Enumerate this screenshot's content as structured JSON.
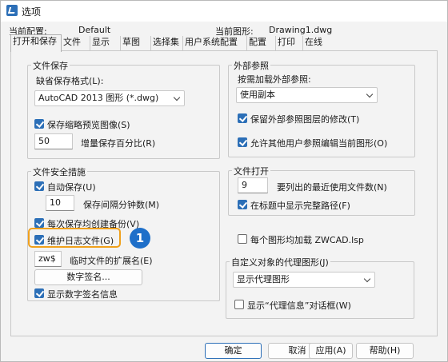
{
  "window": {
    "title": "选项"
  },
  "profile": {
    "current_profile_label": "当前配置:",
    "current_profile_value": "Default",
    "current_drawing_label": "当前图形:",
    "current_drawing_value": "Drawing1.dwg"
  },
  "tabs": [
    {
      "label": "打开和保存",
      "active": true
    },
    {
      "label": "文件"
    },
    {
      "label": "显示"
    },
    {
      "label": "草图"
    },
    {
      "label": "选择集"
    },
    {
      "label": "用户系统配置"
    },
    {
      "label": "配置"
    },
    {
      "label": "打印"
    },
    {
      "label": "在线"
    }
  ],
  "file_save": {
    "title": "文件保存",
    "format_label": "缺省保存格式(L):",
    "format_value": "AutoCAD 2013 图形 (*.dwg)",
    "thumbnail_label": "保存缩略预览图像(S)",
    "thumbnail_checked": true,
    "increment_value": "50",
    "increment_label": "增量保存百分比(R)"
  },
  "file_safety": {
    "title": "文件安全措施",
    "autosave_label": "自动保存(U)",
    "autosave_checked": true,
    "minutes_value": "10",
    "minutes_label": "保存间隔分钟数(M)",
    "backup_label": "每次保存均创建备份(V)",
    "backup_checked": true,
    "log_label": "维护日志文件(G)",
    "log_checked": true,
    "ext_value": "zw$",
    "ext_label": "临时文件的扩展名(E)",
    "digital_sign_button": "数字签名...",
    "show_sign_label": "显示数字签名信息",
    "show_sign_checked": true
  },
  "xref": {
    "title": "外部参照",
    "load_label": "按需加载外部参照:",
    "load_value": "使用副本",
    "retain_label": "保留外部参照图层的修改(T)",
    "retain_checked": true,
    "allow_label": "允许其他用户参照编辑当前图形(O)",
    "allow_checked": true
  },
  "file_open": {
    "title": "文件打开",
    "recent_value": "9",
    "recent_label": "要列出的最近使用文件数(N)",
    "fullpath_label": "在标题中显示完整路径(F)",
    "fullpath_checked": true
  },
  "load_lsp": {
    "label": "每个图形均加载 ZWCAD.lsp",
    "checked": false
  },
  "proxy": {
    "title": "自定义对象的代理图形(J)",
    "value": "显示代理图形",
    "show_info_label": "显示“代理信息”对话框(W)",
    "show_info_checked": false
  },
  "annotation": {
    "badge": "1"
  },
  "buttons": {
    "ok": "确定",
    "cancel": "取消",
    "apply": "应用(A)",
    "help": "帮助(H)"
  }
}
